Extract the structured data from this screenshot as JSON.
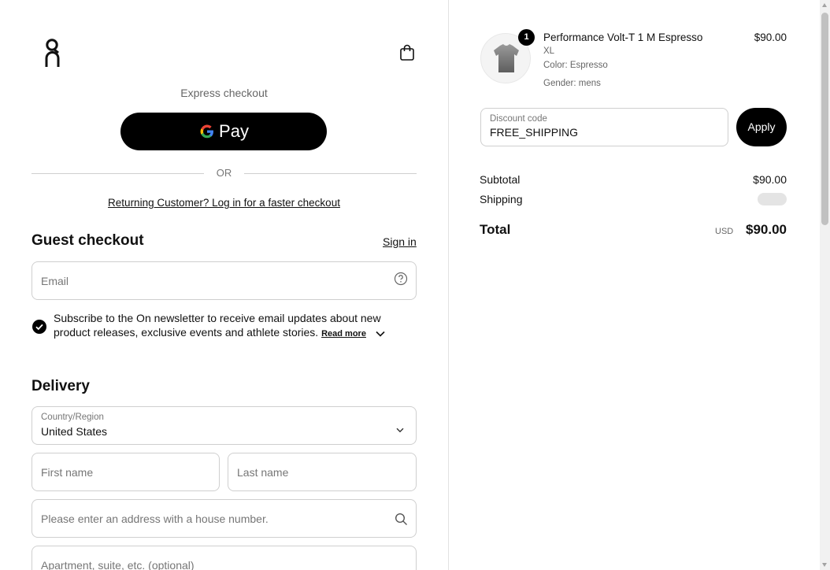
{
  "header": {
    "logo_icon": "on-brand-logo-icon",
    "cart_icon": "shopping-bag-icon"
  },
  "express": {
    "label": "Express checkout",
    "gpay_label": "Pay",
    "or_text": "OR"
  },
  "returning_link": "Returning Customer? Log in for a faster checkout",
  "guest": {
    "title": "Guest checkout",
    "signin_label": "Sign in",
    "email_placeholder": "Email",
    "help_icon": "question-circle-icon",
    "newsletter_checked": true,
    "newsletter_text": "Subscribe to the On newsletter to receive email updates about new product releases, exclusive events and athlete stories.",
    "read_more": "Read more"
  },
  "delivery": {
    "title": "Delivery",
    "country_label": "Country/Region",
    "country_value": "United States",
    "first_name_placeholder": "First name",
    "last_name_placeholder": "Last name",
    "address_placeholder": "Please enter an address with a house number.",
    "apartment_placeholder": "Apartment, suite, etc. (optional)"
  },
  "cart": {
    "item": {
      "quantity": "1",
      "name": "Performance Volt-T 1 M Espresso",
      "price": "$90.00",
      "size": "XL",
      "color": "Color: Espresso",
      "gender": "Gender: mens"
    },
    "discount_label": "Discount code",
    "discount_value": "FREE_SHIPPING",
    "apply_label": "Apply",
    "subtotal_label": "Subtotal",
    "subtotal_value": "$90.00",
    "shipping_label": "Shipping",
    "total_label": "Total",
    "total_currency": "USD",
    "total_value": "$90.00"
  },
  "colors": {
    "primary": "#000000",
    "border": "#cfcfcf",
    "muted_text": "#767676"
  }
}
